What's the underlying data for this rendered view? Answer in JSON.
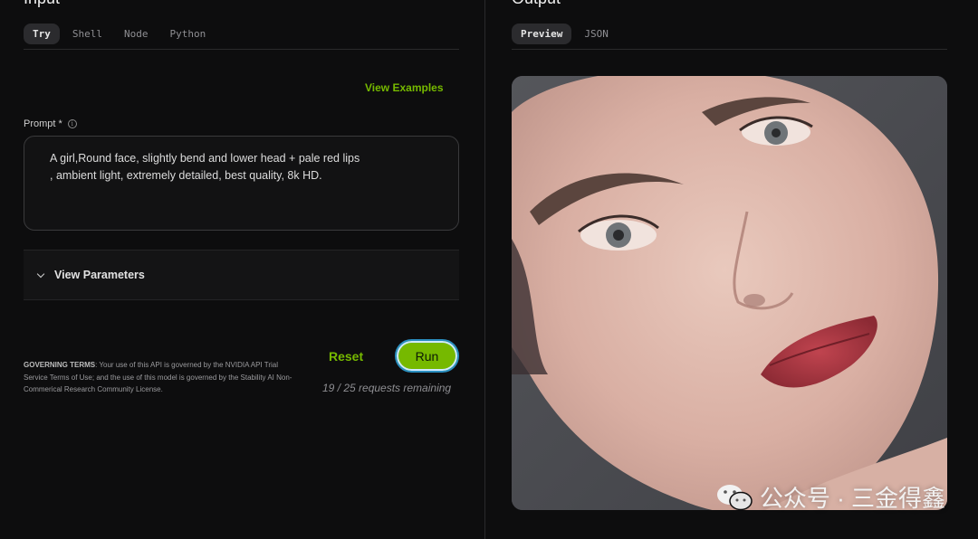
{
  "left": {
    "title": "Input",
    "tabs": [
      {
        "label": "Try",
        "active": true
      },
      {
        "label": "Shell",
        "active": false
      },
      {
        "label": "Node",
        "active": false
      },
      {
        "label": "Python",
        "active": false
      }
    ],
    "view_examples": "View Examples",
    "prompt_label": "Prompt *",
    "prompt_info_icon": "info-icon",
    "prompt_value": "A girl,Round face, slightly bend and lower head + pale red lips\n, ambient light, extremely detailed, best quality, 8k HD.",
    "params_label": "View Parameters",
    "terms_heading": "GOVERNING TERMS",
    "terms_body": ": Your use of this API is governed by the NVIDIA API Trial Service Terms of Use; and the use of this model is governed by the Stability AI Non-Commerical Research Community License.",
    "reset_label": "Reset",
    "run_label": "Run",
    "remaining": "19 / 25 requests remaining"
  },
  "right": {
    "title": "Output",
    "tabs": [
      {
        "label": "Preview",
        "active": true
      },
      {
        "label": "JSON",
        "active": false
      }
    ],
    "preview_alt": "generated portrait"
  },
  "watermark": {
    "text": "公众号 · 三金得鑫",
    "icon": "wechat-icon"
  },
  "colors": {
    "accent": "#76b900",
    "background": "#0d0d0e"
  }
}
